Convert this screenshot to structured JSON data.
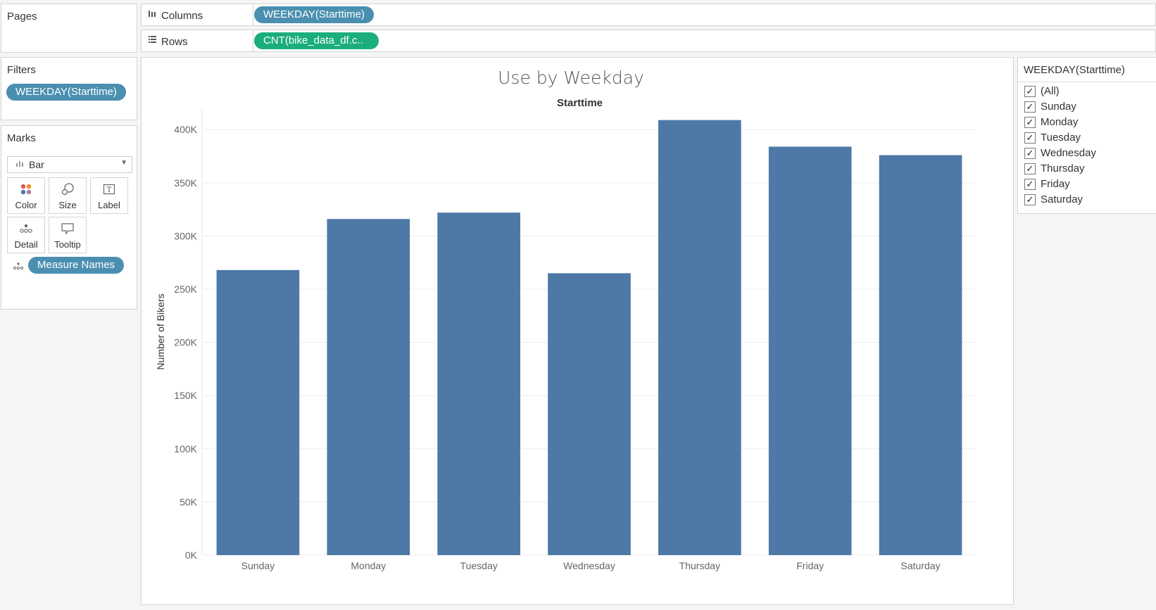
{
  "pages": {
    "title": "Pages"
  },
  "filters": {
    "title": "Filters",
    "pills": [
      "WEEKDAY(Starttime)"
    ]
  },
  "marks": {
    "title": "Marks",
    "mark_type": "Bar",
    "buttons": [
      {
        "label": "Color",
        "icon": "color-icon"
      },
      {
        "label": "Size",
        "icon": "size-icon"
      },
      {
        "label": "Label",
        "icon": "label-icon"
      },
      {
        "label": "Detail",
        "icon": "detail-icon"
      },
      {
        "label": "Tooltip",
        "icon": "tooltip-icon"
      }
    ],
    "detail_pill": "Measure Names"
  },
  "shelves": {
    "columns": {
      "label": "Columns",
      "pill": "WEEKDAY(Starttime)"
    },
    "rows": {
      "label": "Rows",
      "pill": "CNT(bike_data_df.c.."
    }
  },
  "colors": {
    "bar": "#4e79a7",
    "pill_blue": "#4a8fb0",
    "pill_green": "#1bae7a"
  },
  "chart_data": {
    "type": "bar",
    "title": "Use by Weekday",
    "subtitle": "Starttime",
    "ylabel": "Number of Bikers",
    "categories": [
      "Sunday",
      "Monday",
      "Tuesday",
      "Wednesday",
      "Thursday",
      "Friday",
      "Saturday"
    ],
    "values": [
      268000,
      316000,
      322000,
      265000,
      409000,
      384000,
      376000
    ],
    "ylim": [
      0,
      420000
    ],
    "yticks": [
      0,
      50000,
      100000,
      150000,
      200000,
      250000,
      300000,
      350000,
      400000
    ],
    "ytick_labels": [
      "0K",
      "50K",
      "100K",
      "150K",
      "200K",
      "250K",
      "300K",
      "350K",
      "400K"
    ],
    "grid": true
  },
  "filter_card": {
    "title": "WEEKDAY(Starttime)",
    "items": [
      {
        "label": "(All)",
        "checked": true
      },
      {
        "label": "Sunday",
        "checked": true
      },
      {
        "label": "Monday",
        "checked": true
      },
      {
        "label": "Tuesday",
        "checked": true
      },
      {
        "label": "Wednesday",
        "checked": true
      },
      {
        "label": "Thursday",
        "checked": true
      },
      {
        "label": "Friday",
        "checked": true
      },
      {
        "label": "Saturday",
        "checked": true
      }
    ]
  }
}
